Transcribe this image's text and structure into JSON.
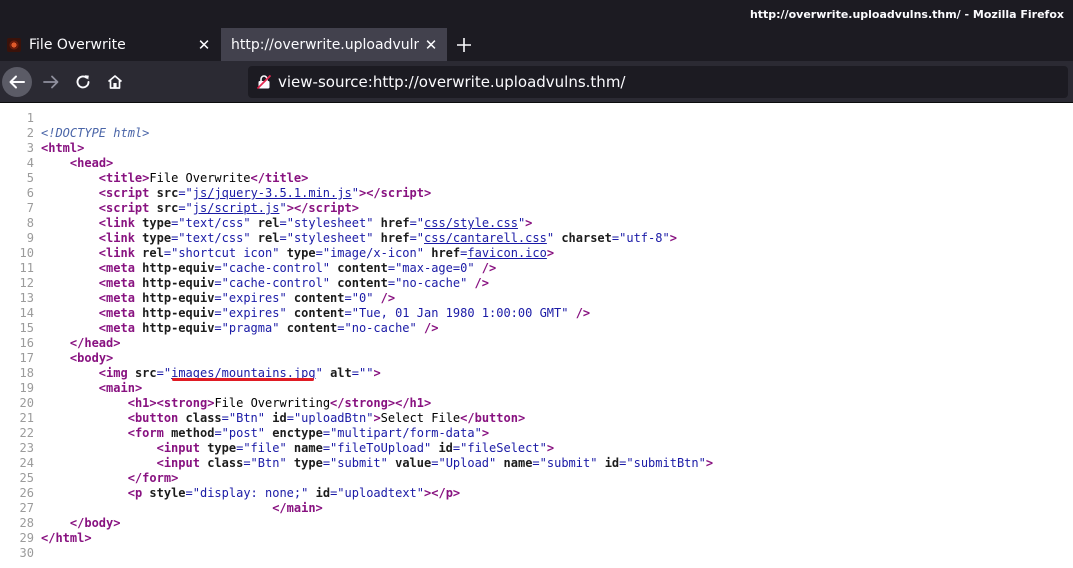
{
  "window": {
    "title": "http://overwrite.uploadvulns.thm/ - Mozilla Firefox"
  },
  "tabs": [
    {
      "label": "File Overwrite",
      "icon": "site-favicon",
      "active": false
    },
    {
      "label": "http://overwrite.uploadvulns.thm/",
      "active": true
    }
  ],
  "toolbar": {
    "url": "view-source:http://overwrite.uploadvulns.thm/",
    "url_icon": "insecure-lock-icon"
  },
  "source": {
    "line_numbers": [
      "1",
      "2",
      "3",
      "4",
      "5",
      "6",
      "7",
      "8",
      "9",
      "10",
      "11",
      "12",
      "13",
      "14",
      "15",
      "16",
      "17",
      "18",
      "19",
      "20",
      "21",
      "22",
      "23",
      "24",
      "25",
      "26",
      "27",
      "28",
      "29",
      "30"
    ],
    "doctype": "<!DOCTYPE html>",
    "strings": {
      "lt": "<",
      "gt": ">",
      "lt_slash": "</",
      "eq_q": "=\"",
      "q": "\"",
      "q_gt": "\">",
      "self_close": " />",
      "html": "html",
      "head": "head",
      "title": "title",
      "script": "script",
      "link": "link",
      "meta": "meta",
      "body": "body",
      "img": "img",
      "main": "main",
      "h1": "h1",
      "strong": "strong",
      "button": "button",
      "form": "form",
      "input": "input",
      "p": "p",
      "src": "src",
      "type": "type",
      "rel": "rel",
      "href": "href",
      "charset": "charset",
      "http_equiv": "http-equiv",
      "content": "content",
      "alt": "alt",
      "class": "class",
      "id": "id",
      "method": "method",
      "enctype": "enctype",
      "name": "name",
      "value": "value",
      "style": "style",
      "title_text": "File Overwrite",
      "js_jquery": "js/jquery-3.5.1.min.js",
      "js_script": "js/script.js",
      "text_css": "text/css",
      "stylesheet": "stylesheet",
      "css_style": "css/style.css",
      "css_cantarell": "css/cantarell.css",
      "utf8": "utf-8",
      "shortcut_icon": "shortcut icon",
      "image_xicon": "image/x-icon",
      "favicon": "favicon.ico",
      "cache_control": "cache-control",
      "max_age": "max-age=0",
      "no_cache": "no-cache",
      "expires": "expires",
      "zero": "0",
      "expires_date": "Tue, 01 Jan 1980 1:00:00 GMT",
      "pragma": "pragma",
      "img_src": "images/mountains.jpg",
      "empty": "",
      "h1_text": "File Overwriting",
      "btn_class": "Btn",
      "upload_btn_id": "uploadBtn",
      "select_file": "Select File",
      "post": "post",
      "multipart": "multipart/form-data",
      "file": "file",
      "file_to_upload": "fileToUpload",
      "file_select": "fileSelect",
      "submit": "submit",
      "upload": "Upload",
      "submit_btn": "submitBtn",
      "display_none": "display: none;",
      "upload_text": "uploadtext"
    }
  }
}
